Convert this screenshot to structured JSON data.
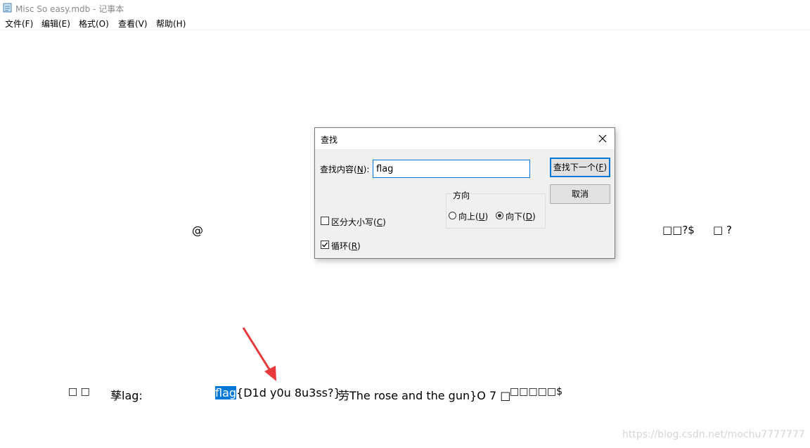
{
  "window": {
    "title": "Misc So easy.mdb - 记事本"
  },
  "menu": [
    "文件(F)",
    "编辑(E)",
    "格式(O)",
    "查看(V)",
    "帮助(H)"
  ],
  "content": {
    "at_sign": "@",
    "right_mid_1": "□□?$",
    "right_mid_2": "□ ?",
    "bottom_boxes": "□ □",
    "lag_label": "孳lag:",
    "flag_selected": "flag",
    "flag_rest": "{D1d y0u 8u3ss?}",
    "rose_text": "劳The rose and the gun}O 7 □",
    "tail_text": "□□□□□$"
  },
  "watermark": "https://blog.csdn.net/mochu7777777",
  "dialog": {
    "title": "查找",
    "find_label_pre": "查找内容(",
    "find_label_key": "N",
    "find_label_post": "):",
    "find_value": "flag",
    "find_next_pre": "查找下一个(",
    "find_next_key": "F",
    "find_next_post": ")",
    "cancel": "取消",
    "direction_label": "方向",
    "up_pre": "向上(",
    "up_key": "U",
    "up_post": ")",
    "down_pre": "向下(",
    "down_key": "D",
    "down_post": ")",
    "match_case_pre": "区分大小写(",
    "match_case_key": "C",
    "match_case_post": ")",
    "wrap_pre": "循环(",
    "wrap_key": "R",
    "wrap_post": ")",
    "direction_selected": "down",
    "match_case_checked": false,
    "wrap_checked": true
  },
  "colors": {
    "selection": "#0078d7",
    "arrow": "#e8393c",
    "focus": "#0078d7"
  }
}
